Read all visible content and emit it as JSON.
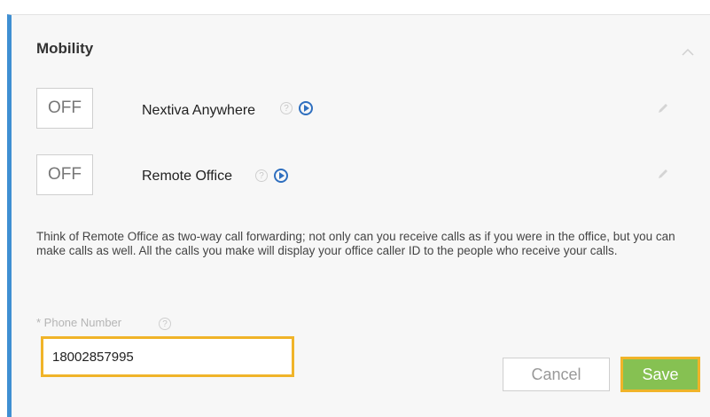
{
  "section": {
    "title": "Mobility"
  },
  "rows": [
    {
      "toggle": "OFF",
      "label": "Nextiva Anywhere"
    },
    {
      "toggle": "OFF",
      "label": "Remote Office"
    }
  ],
  "description": "Think of Remote Office as two-way call forwarding; not only can you receive calls as if you were in the office, but you can make calls as well. All the calls you make will display your office caller ID to the people who receive your calls.",
  "phone": {
    "label": "* Phone Number",
    "value": "18002857995"
  },
  "buttons": {
    "cancel": "Cancel",
    "save": "Save"
  },
  "colors": {
    "accent_border": "#3f8fd2",
    "focus": "#f0b429",
    "save": "#86c152",
    "icon_blue": "#2f6fbf"
  },
  "icons": {
    "help": "?"
  }
}
